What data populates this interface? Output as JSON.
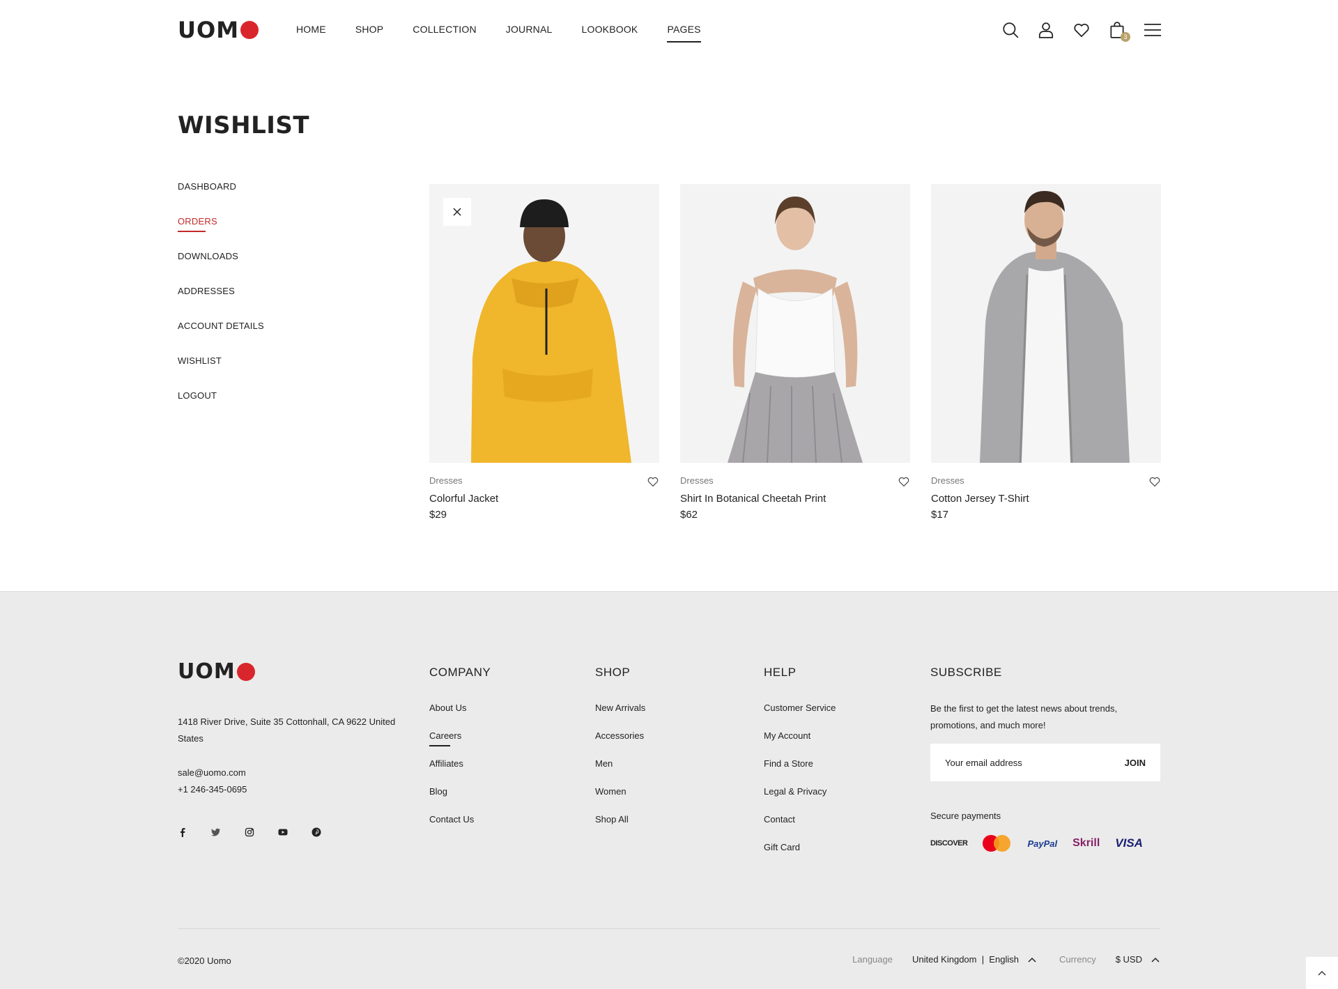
{
  "brand": {
    "logo_text": "UOM",
    "logo_dot_color": "#d9262c",
    "accent_color": "#c32929"
  },
  "nav": {
    "items": [
      {
        "label": "HOME"
      },
      {
        "label": "SHOP"
      },
      {
        "label": "COLLECTION"
      },
      {
        "label": "JOURNAL"
      },
      {
        "label": "LOOKBOOK"
      },
      {
        "label": "PAGES",
        "active": true
      }
    ]
  },
  "header_icons": {
    "search": "search-icon",
    "account": "user-icon",
    "wishlist": "heart-icon",
    "cart": "bag-icon",
    "cart_count": "3",
    "menu": "hamburger-menu-icon"
  },
  "page": {
    "title": "WISHLIST"
  },
  "sidebar": {
    "items": [
      {
        "label": "DASHBOARD"
      },
      {
        "label": "ORDERS",
        "active": true
      },
      {
        "label": "DOWNLOADS"
      },
      {
        "label": "ADDRESSES"
      },
      {
        "label": "ACCOUNT DETAILS"
      },
      {
        "label": "WISHLIST"
      },
      {
        "label": "LOGOUT"
      }
    ]
  },
  "products": [
    {
      "category": "Dresses",
      "name": "Colorful Jacket",
      "price": "$29",
      "image": "man-yellow-anorak-photo"
    },
    {
      "category": "Dresses",
      "name": "Shirt In Botanical Cheetah Print",
      "price": "$62",
      "image": "woman-white-top-grey-skirt-photo"
    },
    {
      "category": "Dresses",
      "name": "Cotton Jersey T-Shirt",
      "price": "$17",
      "image": "man-grey-hoodie-photo"
    }
  ],
  "footer": {
    "address": "1418 River Drive, Suite 35 Cottonhall, CA 9622 United States",
    "email": "sale@uomo.com",
    "phone": "+1 246-345-0695",
    "social": [
      "facebook-icon",
      "twitter-icon",
      "instagram-icon",
      "youtube-icon",
      "pinterest-icon"
    ],
    "company": {
      "title": "COMPANY",
      "links": [
        "About Us",
        "Careers",
        "Affiliates",
        "Blog",
        "Contact Us"
      ]
    },
    "shop": {
      "title": "SHOP",
      "links": [
        "New Arrivals",
        "Accessories",
        "Men",
        "Women",
        "Shop All"
      ]
    },
    "help": {
      "title": "HELP",
      "links": [
        "Customer Service",
        "My Account",
        "Find a Store",
        "Legal & Privacy",
        "Contact",
        "Gift Card"
      ]
    },
    "subscribe": {
      "title": "SUBSCRIBE",
      "text": "Be the first to get the latest news about trends, promotions, and much more!",
      "placeholder": "Your email address",
      "button": "JOIN",
      "secure_label": "Secure payments",
      "payments": {
        "discover": "DISCOVER",
        "mastercard": "mastercard-logo",
        "paypal": "PayPal",
        "skrill": "Skrill",
        "visa": "VISA"
      }
    },
    "copyright": "©2020 Uomo",
    "language_label": "Language",
    "language_value": "United Kingdom  |  English",
    "currency_label": "Currency",
    "currency_value": "$ USD"
  }
}
